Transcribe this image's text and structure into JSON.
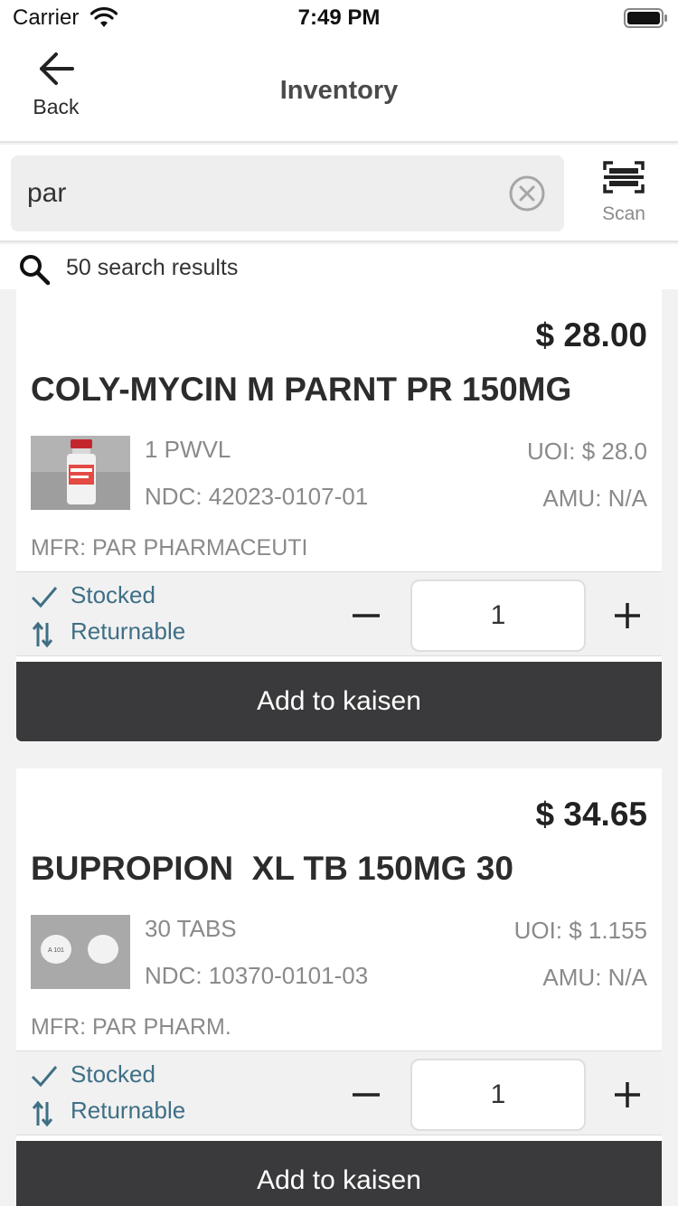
{
  "status_bar": {
    "carrier": "Carrier",
    "time": "7:49 PM"
  },
  "nav": {
    "back_label": "Back",
    "title": "Inventory"
  },
  "search": {
    "value": "par",
    "scan_label": "Scan"
  },
  "results": {
    "count_text": "50 search results"
  },
  "products": [
    {
      "price": "$ 28.00",
      "name": "COLY-MYCIN M PARNT PR 150MG",
      "pack": "1 PWVL",
      "ndc": "NDC: 42023-0107-01",
      "uoi": "UOI: $ 28.0",
      "amu": "AMU: N/A",
      "mfr": "MFR: PAR PHARMACEUTI",
      "stocked": "Stocked",
      "returnable": "Returnable",
      "quantity": "1",
      "add_label": "Add to kaisen"
    },
    {
      "price": "$ 34.65",
      "name": "BUPROPION  XL TB 150MG 30",
      "pack": "30 TABS",
      "ndc": "NDC: 10370-0101-03",
      "uoi": "UOI: $ 1.155",
      "amu": "AMU: N/A",
      "mfr": "MFR: PAR PHARM.",
      "stocked": "Stocked",
      "returnable": "Returnable",
      "quantity": "1",
      "add_label": "Add to kaisen",
      "pill_imprint": "A 101"
    }
  ],
  "colors": {
    "accent_text": "#3f6f85",
    "button_dark": "#3a3a3c"
  }
}
